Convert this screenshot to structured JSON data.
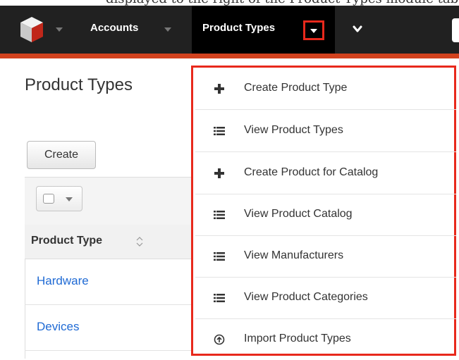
{
  "colors": {
    "navbar": "#212121",
    "nav_active": "#000000",
    "accent_strip": "#d2421e",
    "highlight": "#e8291c",
    "link": "#1f6ad4"
  },
  "page_top_text": "displayed to the right of the Product Types module tab in the navigation bar and select \"View",
  "nav": {
    "logo_icon": "cube-logo-icon",
    "accounts_label": "Accounts",
    "product_types_label": "Product Types",
    "more_icon": "chevron-down-icon"
  },
  "page": {
    "title": "Product Types",
    "create_label": "Create"
  },
  "table": {
    "column_header": "Product Type",
    "rows": [
      "Hardware",
      "Devices"
    ]
  },
  "dropdown": {
    "items": [
      {
        "label": "Create Product Type",
        "icon": "plus-icon"
      },
      {
        "label": "View Product Types",
        "icon": "list-icon"
      },
      {
        "label": "Create Product for Catalog",
        "icon": "plus-icon"
      },
      {
        "label": "View Product Catalog",
        "icon": "list-icon"
      },
      {
        "label": "View Manufacturers",
        "icon": "list-icon"
      },
      {
        "label": "View Product Categories",
        "icon": "list-icon"
      },
      {
        "label": "Import Product Types",
        "icon": "import-icon"
      }
    ]
  }
}
